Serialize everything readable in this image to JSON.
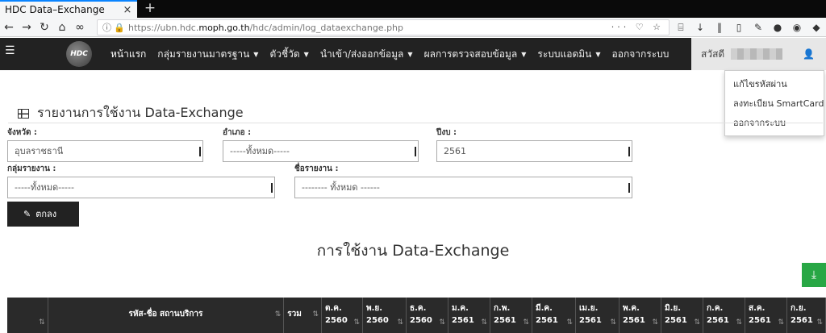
{
  "browser": {
    "tab_title": "HDC Data–Exchange",
    "tab_close": "×",
    "new_tab": "+",
    "url_prefix": "https://ubn.hdc.",
    "url_domain": "moph.go.th",
    "url_path": "/hdc/admin/log_dataexchange.php",
    "url_actions": "··· ♡ ☆"
  },
  "nav": {
    "items": [
      {
        "label": "หน้าแรก",
        "caret": false
      },
      {
        "label": "กลุ่มรายงานมาตรฐาน",
        "caret": true
      },
      {
        "label": "ตัวชี้วัด",
        "caret": true
      },
      {
        "label": "นำเข้า/ส่งออกข้อมูล",
        "caret": true
      },
      {
        "label": "ผลการตรวจสอบข้อมูล",
        "caret": true
      },
      {
        "label": "ระบบแอดมิน",
        "caret": true
      },
      {
        "label": "ออกจากระบบ",
        "caret": false
      }
    ],
    "user_greeting": "สวัสดี",
    "logo_text": "HDC"
  },
  "user_dropdown": [
    "แก้ไขรหัสผ่าน",
    "ลงทะเบียน SmartCard",
    "ออกจากระบบ"
  ],
  "page": {
    "title": "รายงานการใช้งาน Data-Exchange"
  },
  "filters": {
    "province": {
      "label": "จังหวัด :",
      "value": "อุบลราชธานี"
    },
    "district": {
      "label": "อำเภอ :",
      "value": "-----ทั้งหมด-----"
    },
    "year": {
      "label": "ปีงบ :",
      "value": "2561"
    },
    "report_group": {
      "label": "กลุ่มรายงาน :",
      "value": "-----ทั้งหมด-----"
    },
    "report_name": {
      "label": "ชื่อรายงาน :",
      "value": "-------- ทั้งหมด ------"
    }
  },
  "submit_label": "ตกลง",
  "report_title": "การใช้งาน Data-Exchange",
  "table": {
    "sort_icon": "⇅",
    "service_col": "รหัส-ชื่อ สถานบริการ",
    "total_col": "รวม",
    "months": [
      {
        "m": "ต.ค.",
        "y": "2560"
      },
      {
        "m": "พ.ย.",
        "y": "2560"
      },
      {
        "m": "ธ.ค.",
        "y": "2560"
      },
      {
        "m": "ม.ค.",
        "y": "2561"
      },
      {
        "m": "ก.พ.",
        "y": "2561"
      },
      {
        "m": "มี.ค.",
        "y": "2561"
      },
      {
        "m": "เม.ย.",
        "y": "2561"
      },
      {
        "m": "พ.ค.",
        "y": "2561"
      },
      {
        "m": "มิ.ย.",
        "y": "2561"
      },
      {
        "m": "ก.ค.",
        "y": "2561"
      },
      {
        "m": "ส.ค.",
        "y": "2561"
      },
      {
        "m": "ก.ย.",
        "y": "2561"
      }
    ]
  },
  "colors": {
    "navbar": "#222222",
    "download_button": "#28a745",
    "tab_accent": "#0a84ff"
  },
  "icons": [
    "menu-icon",
    "table-icon",
    "edit-icon",
    "download-icon",
    "user-icon"
  ]
}
